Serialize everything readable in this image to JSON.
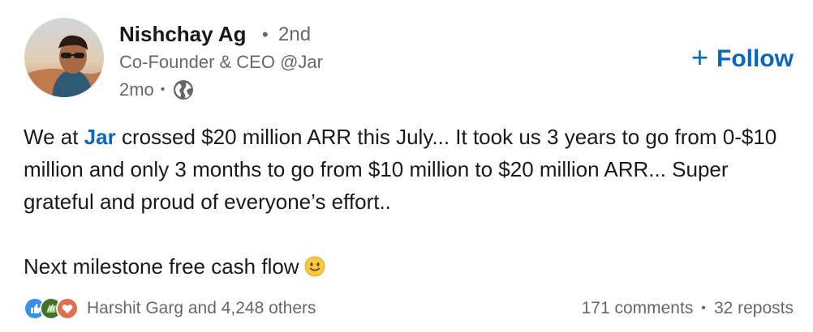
{
  "author": {
    "name": "Nishchay Ag",
    "degree_separator": "•",
    "degree": "2nd",
    "headline": "Co-Founder & CEO @Jar",
    "time": "2mo",
    "time_separator": "•",
    "visibility_icon": "globe-icon"
  },
  "follow": {
    "icon": "plus-icon",
    "plus": "+",
    "label": "Follow",
    "color": "#0a66c2"
  },
  "body": {
    "line1_prefix": "We at ",
    "mention": "Jar",
    "line1_suffix": " crossed $20 million ARR this July... It took us 3 years to go from 0-$10 million and only 3 months to go from $10 million to $20 million ARR... Super grateful and proud of everyone’s effort..",
    "line2": "Next milestone free cash flow",
    "emoji": "slightly-smiling-face"
  },
  "social": {
    "reaction_icons": [
      "like-icon",
      "celebrate-icon",
      "love-icon"
    ],
    "reactions_text": "Harshit Garg and 4,248 others",
    "comments": "171 comments",
    "separator": "•",
    "reposts": "32 reposts"
  }
}
